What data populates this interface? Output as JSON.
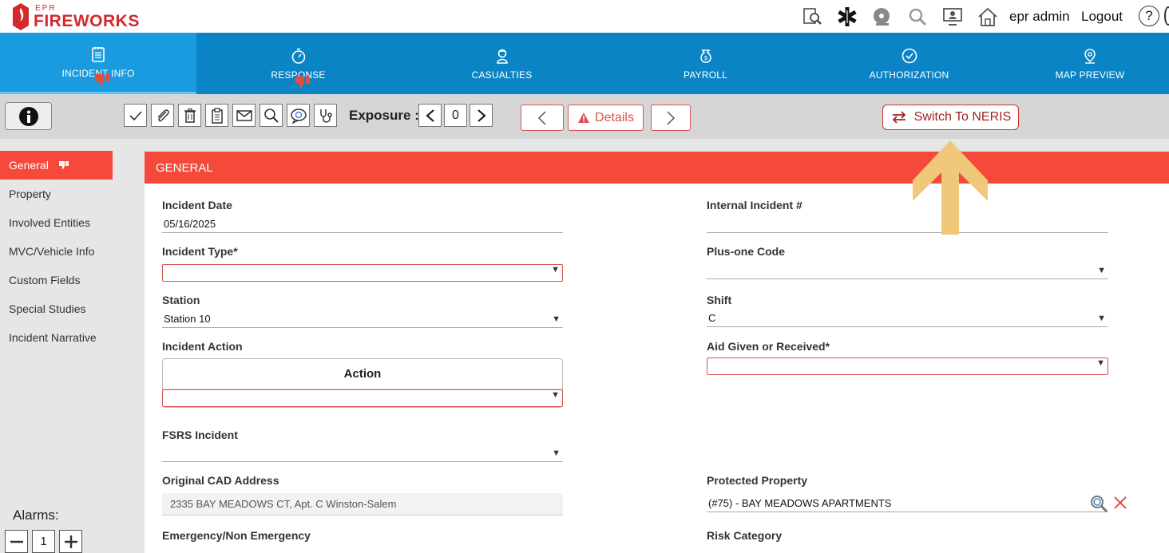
{
  "app": {
    "logo_small": "EPR",
    "logo_big": "FIREWORKS"
  },
  "header": {
    "user": "epr admin",
    "logout": "Logout",
    "help": "?",
    "icons": [
      "search-document-icon",
      "star-of-life-icon",
      "disc-icon",
      "magnify-icon",
      "monitor-user-icon",
      "home-icon"
    ]
  },
  "nav": {
    "tabs": [
      {
        "label": "INCIDENT INFO",
        "icon": "notepad-icon",
        "active": true,
        "flag": true
      },
      {
        "label": "RESPONSE",
        "icon": "stopwatch-icon",
        "active": false,
        "flag": true
      },
      {
        "label": "CASUALTIES",
        "icon": "casualty-icon",
        "active": false,
        "flag": false
      },
      {
        "label": "PAYROLL",
        "icon": "money-bag-icon",
        "active": false,
        "flag": false
      },
      {
        "label": "AUTHORIZATION",
        "icon": "check-circle-icon",
        "active": false,
        "flag": false
      },
      {
        "label": "MAP PREVIEW",
        "icon": "map-pin-icon",
        "active": false,
        "flag": false
      }
    ]
  },
  "toolbar": {
    "exposure_label": "Exposure :",
    "exposure_value": "0",
    "details_label": "Details",
    "neris_label": "Switch To NERIS"
  },
  "sidebar": {
    "items": [
      {
        "label": "General",
        "active": true
      },
      {
        "label": "Property",
        "active": false
      },
      {
        "label": "Involved Entities",
        "active": false
      },
      {
        "label": "MVC/Vehicle Info",
        "active": false
      },
      {
        "label": "Custom Fields",
        "active": false
      },
      {
        "label": "Special Studies",
        "active": false
      },
      {
        "label": "Incident Narrative",
        "active": false
      }
    ],
    "alarms_label": "Alarms:",
    "alarms_value": "1"
  },
  "panel": {
    "title": "GENERAL"
  },
  "form": {
    "incident_date": {
      "label": "Incident Date",
      "value": "05/16/2025"
    },
    "internal_incident": {
      "label": "Internal Incident #",
      "value": ""
    },
    "incident_type": {
      "label": "Incident Type*",
      "value": ""
    },
    "plus_one_code": {
      "label": "Plus-one Code",
      "value": ""
    },
    "station": {
      "label": "Station",
      "value": "Station 10"
    },
    "shift": {
      "label": "Shift",
      "value": "C"
    },
    "incident_action": {
      "label": "Incident Action",
      "header": "Action",
      "value": ""
    },
    "aid_given": {
      "label": "Aid Given or Received*",
      "value": ""
    },
    "fsrs_incident": {
      "label": "FSRS Incident",
      "value": ""
    },
    "original_cad": {
      "label": "Original CAD Address",
      "value": "2335 BAY MEADOWS CT, Apt. C Winston-Salem"
    },
    "protected_property": {
      "label": "Protected Property",
      "value": "(#75) -  BAY MEADOWS APARTMENTS"
    },
    "emergency": {
      "label": "Emergency/Non Emergency"
    },
    "risk_category": {
      "label": "Risk Category"
    }
  },
  "colors": {
    "brand_red": "#d4282b",
    "nav_blue": "#0b84c6",
    "accent_red": "#f4493b",
    "annotation_arrow": "#f0c87a"
  }
}
